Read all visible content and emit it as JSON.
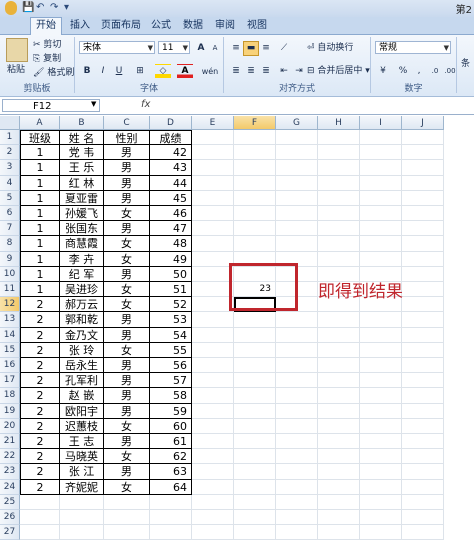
{
  "title_text": "第2",
  "quick_access": {
    "save_icon": "💾",
    "undo_icon": "↶",
    "redo_icon": "↷",
    "customize_icon": "▾"
  },
  "tabs": [
    {
      "label": "开始",
      "active": true
    },
    {
      "label": "插入",
      "active": false
    },
    {
      "label": "页面布局",
      "active": false
    },
    {
      "label": "公式",
      "active": false
    },
    {
      "label": "数据",
      "active": false
    },
    {
      "label": "审阅",
      "active": false
    },
    {
      "label": "视图",
      "active": false
    }
  ],
  "ribbon": {
    "clipboard": {
      "paste": "粘贴",
      "cut": "剪切",
      "copy": "复制",
      "format_painter": "格式刷",
      "group": "剪贴板"
    },
    "font": {
      "name": "宋体",
      "size": "11",
      "grow": "A",
      "shrink": "A",
      "bold": "B",
      "italic": "I",
      "underline": "U",
      "phonetic": "wén",
      "group": "字体"
    },
    "alignment": {
      "wrap": "自动换行",
      "merge": "合并后居中",
      "group": "对齐方式"
    },
    "number": {
      "format": "常规",
      "percent": "%",
      "comma": ",",
      "group": "数字"
    },
    "more": "条"
  },
  "formula_bar": {
    "name_box": "F12",
    "fx": "fx",
    "value": ""
  },
  "sheet": {
    "columns": [
      "A",
      "B",
      "C",
      "D",
      "E",
      "F",
      "G",
      "H",
      "I",
      "J"
    ],
    "selected_column": "F",
    "selected_row": 12,
    "row_numbers": [
      "1",
      "2",
      "3",
      "4",
      "5",
      "6",
      "7",
      "8",
      "9",
      "10",
      "11",
      "12",
      "13",
      "14",
      "15",
      "16",
      "17",
      "18",
      "19",
      "20",
      "21",
      "22",
      "23",
      "24",
      "25",
      "26",
      "27"
    ],
    "header": [
      "班级",
      "姓  名",
      "性别",
      "成绩"
    ],
    "rows": [
      [
        "1",
        "党  韦",
        "男",
        "42"
      ],
      [
        "1",
        "王  乐",
        "男",
        "43"
      ],
      [
        "1",
        "红  林",
        "男",
        "44"
      ],
      [
        "1",
        "夏亚雷",
        "男",
        "45"
      ],
      [
        "1",
        "孙媛飞",
        "女",
        "46"
      ],
      [
        "1",
        "张国东",
        "男",
        "47"
      ],
      [
        "1",
        "商慧霞",
        "女",
        "48"
      ],
      [
        "1",
        "李  卉",
        "女",
        "49"
      ],
      [
        "1",
        "纪  军",
        "男",
        "50"
      ],
      [
        "1",
        "吴进珍",
        "女",
        "51"
      ],
      [
        "2",
        "郝万云",
        "女",
        "52"
      ],
      [
        "2",
        "郭和乾",
        "男",
        "53"
      ],
      [
        "2",
        "金乃文",
        "男",
        "54"
      ],
      [
        "2",
        "张  玲",
        "女",
        "55"
      ],
      [
        "2",
        "岳永生",
        "男",
        "56"
      ],
      [
        "2",
        "孔军利",
        "男",
        "57"
      ],
      [
        "2",
        "赵  嵌",
        "男",
        "58"
      ],
      [
        "2",
        "欧阳宇",
        "男",
        "59"
      ],
      [
        "2",
        "迟蕙枝",
        "女",
        "60"
      ],
      [
        "2",
        "王  志",
        "男",
        "61"
      ],
      [
        "2",
        "马晓英",
        "女",
        "62"
      ],
      [
        "2",
        "张  江",
        "男",
        "63"
      ],
      [
        "2",
        "齐妮妮",
        "女",
        "64"
      ]
    ],
    "f11_value": "23"
  },
  "annotation": "即得到结果",
  "colors": {
    "accent": "#c0262d",
    "ribbon": "#dce8f6",
    "selected_header": "#f3c96a"
  }
}
